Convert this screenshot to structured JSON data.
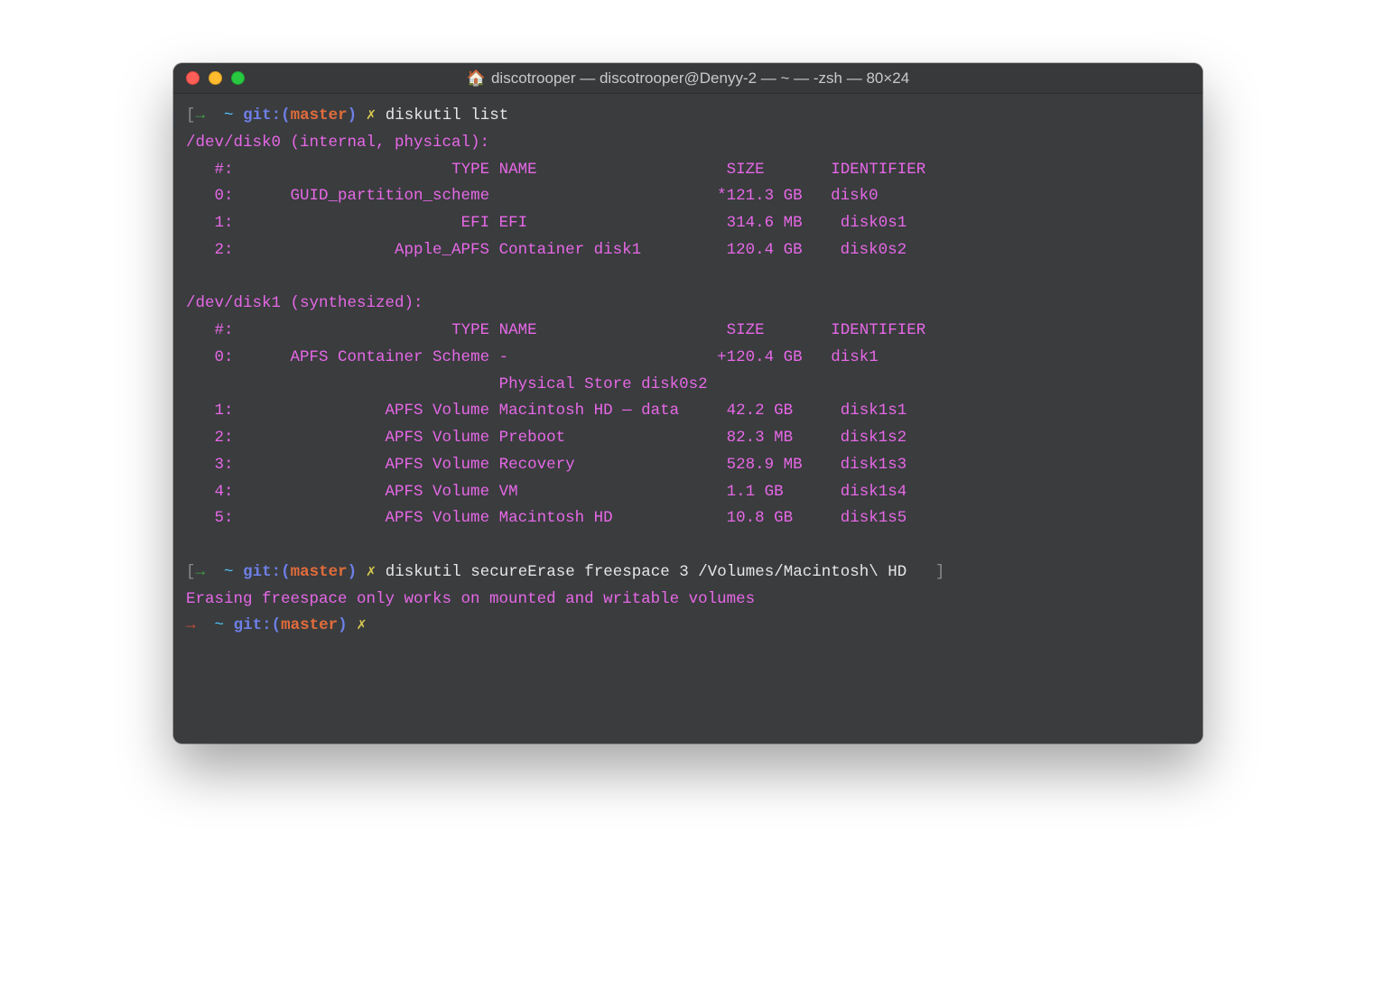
{
  "window": {
    "title": "discotrooper — discotrooper@Denyy-2 — ~ — -zsh — 80×24",
    "home_icon": "🏠"
  },
  "prompt": {
    "bracket_open": "[",
    "bracket_close": "]",
    "arrow": "→",
    "tilde": "~",
    "git_label": "git:(",
    "branch": "master",
    "git_close": ")",
    "x": "✗"
  },
  "cmd1": "diskutil list",
  "out": {
    "d0_header": "/dev/disk0 (internal, physical):",
    "h_num": "   #:",
    "h_type": "TYPE",
    "h_name": "NAME",
    "h_size": "SIZE",
    "h_id": "IDENTIFIER",
    "r0_num": "   0:",
    "r0_type": "GUID_partition_scheme",
    "r0_size": "*121.3 GB",
    "r0_id": "disk0",
    "r1_num": "   1:",
    "r1_type": "EFI",
    "r1_name": "EFI",
    "r1_size": "314.6 MB",
    "r1_id": "disk0s1",
    "r2_num": "   2:",
    "r2_type": "Apple_APFS",
    "r2_name": "Container disk1",
    "r2_size": "120.4 GB",
    "r2_id": "disk0s2",
    "d1_header": "/dev/disk1 (synthesized):",
    "s0_num": "   0:",
    "s0_type": "APFS Container Scheme",
    "s0_name": "-",
    "s0_size": "+120.4 GB",
    "s0_id": "disk1",
    "s0_sub": "Physical Store disk0s2",
    "s1_num": "   1:",
    "s1_type": "APFS Volume",
    "s1_name": "Macintosh HD — data",
    "s1_size": "42.2 GB",
    "s1_id": "disk1s1",
    "s2_num": "   2:",
    "s2_type": "APFS Volume",
    "s2_name": "Preboot",
    "s2_size": "82.3 MB",
    "s2_id": "disk1s2",
    "s3_num": "   3:",
    "s3_type": "APFS Volume",
    "s3_name": "Recovery",
    "s3_size": "528.9 MB",
    "s3_id": "disk1s3",
    "s4_num": "   4:",
    "s4_type": "APFS Volume",
    "s4_name": "VM",
    "s4_size": "1.1 GB",
    "s4_id": "disk1s4",
    "s5_num": "   5:",
    "s5_type": "APFS Volume",
    "s5_name": "Macintosh HD",
    "s5_size": "10.8 GB",
    "s5_id": "disk1s5"
  },
  "cmd2": "diskutil secureErase freespace 3 /Volumes/Macintosh\\ HD",
  "err": "Erasing freespace only works on mounted and writable volumes"
}
